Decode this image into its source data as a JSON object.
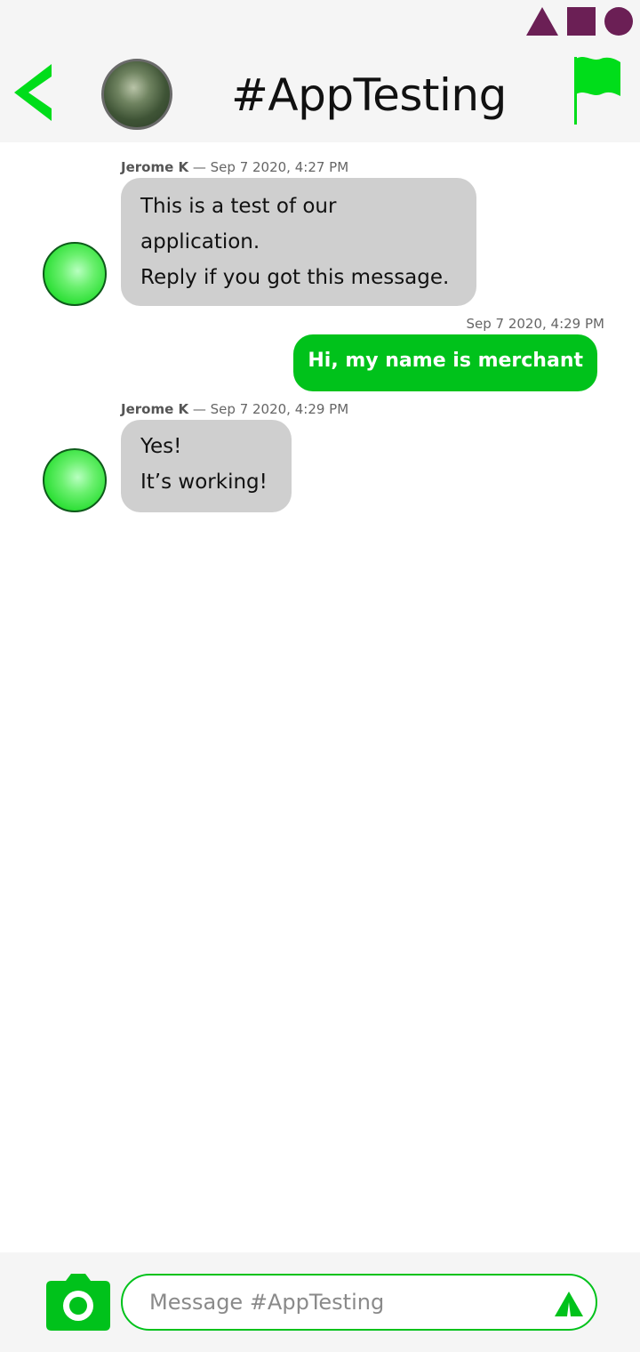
{
  "header": {
    "title": "#AppTesting",
    "accent_color": "#00dd1a",
    "status_icons": [
      "triangle-icon",
      "square-icon",
      "circle-icon"
    ],
    "status_color": "#6b1f55"
  },
  "messages": [
    {
      "author": "Jerome K",
      "separator": " — ",
      "timestamp": "Sep 7 2020, 4:27 PM",
      "line1": "This is a test of our application.",
      "line2": "Reply if you got this message."
    },
    {
      "timestamp": "Sep 7 2020, 4:29 PM",
      "text": "Hi, my name is merchant"
    },
    {
      "author": "Jerome K",
      "separator": " — ",
      "timestamp": "Sep 7 2020, 4:29 PM",
      "line1": "Yes!",
      "line2": "It’s working!"
    }
  ],
  "composer": {
    "placeholder": "Message #AppTesting",
    "accent_color": "#00c21b"
  }
}
